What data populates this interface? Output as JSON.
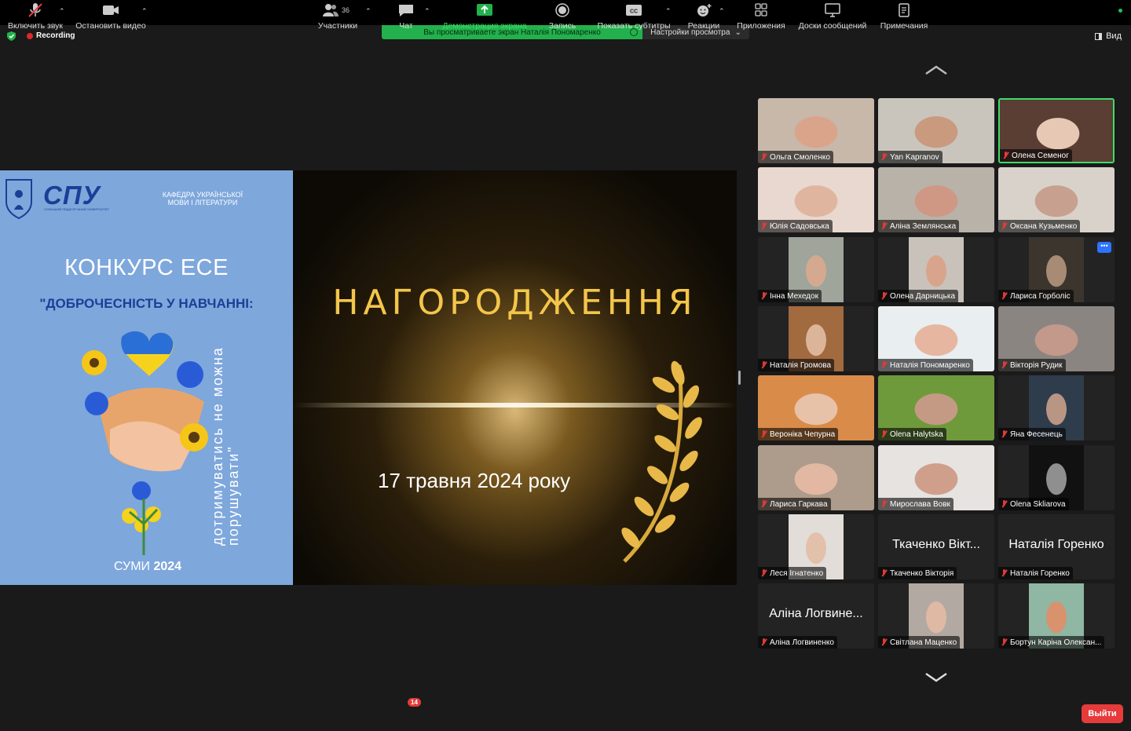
{
  "top": {
    "recording": "Recording",
    "share_banner": "Вы просматриваете экран Наталія Пономаренко",
    "view_settings": "Настройки просмотра",
    "view": "Вид"
  },
  "slide": {
    "logo": "СПУ",
    "logo_sub": "СУМСЬКИЙ ПЕДАГОГІЧНИЙ УНІВЕРСИТЕТ",
    "department": "КАФЕДРА УКРАЇНСЬКОЇ МОВИ І ЛІТЕРАТУРИ",
    "contest": "КОНКУРС ЕСЕ",
    "contest_subtitle": "\"ДОБРОЧЕСНІСТЬ У НАВЧАННІ:",
    "vertical_line1": "дотримуватись   не   можна",
    "vertical_line2": "порушувати\"",
    "city": "СУМИ",
    "year": "2024",
    "award_title": "НАГОРОДЖЕННЯ",
    "award_date": "17 травня 2024 року"
  },
  "participants": [
    {
      "name": "Ольга Смоленко",
      "video": true,
      "bg": "#c7b8aa",
      "face": "#d9a48a"
    },
    {
      "name": "Yan Kapranov",
      "video": true,
      "bg": "#c9c5bd",
      "face": "#c99a7e"
    },
    {
      "name": "Олена Семеног",
      "video": true,
      "bg": "#5a3d33",
      "face": "#e6c8b4",
      "active": true
    },
    {
      "name": "Юлія Садовська",
      "video": true,
      "bg": "#e8d8cf",
      "face": "#e0b59f"
    },
    {
      "name": "Аліна Землянська",
      "video": true,
      "bg": "#b9b2a8",
      "face": "#cf9884"
    },
    {
      "name": "Оксана Кузьменко",
      "video": true,
      "bg": "#d8d2ca",
      "face": "#c7a08f"
    },
    {
      "name": "Інна Мехедок",
      "video": true,
      "bg": "#9fa59a",
      "face": "#d4a990",
      "narrow": true
    },
    {
      "name": "Олена Дарницька",
      "video": true,
      "bg": "#c8c2bb",
      "face": "#d8a58c",
      "narrow": true
    },
    {
      "name": "Лариса Горболіс",
      "video": true,
      "bg": "#3b352e",
      "face": "#a88b75",
      "narrow": true,
      "more": true
    },
    {
      "name": "Наталія Громова",
      "video": true,
      "bg": "#a26a3f",
      "face": "#dcb49a",
      "narrow": true
    },
    {
      "name": "Наталія Пономаренко",
      "video": true,
      "bg": "#e9eef0",
      "face": "#e6b6a0"
    },
    {
      "name": "Вікторія Рудик",
      "video": true,
      "bg": "#8a8581",
      "face": "#c2998a"
    },
    {
      "name": "Вероніка Чепурна",
      "video": true,
      "bg": "#d98c4a",
      "face": "#e8c2a8"
    },
    {
      "name": "Olena Halytska",
      "video": true,
      "bg": "#6f9a3c",
      "face": "#c59a85"
    },
    {
      "name": "Яна Фесенець",
      "video": true,
      "bg": "#2f3c4b",
      "face": "#b99683",
      "narrow": true
    },
    {
      "name": "Лариса Гаркава",
      "video": true,
      "bg": "#ad9b8b",
      "face": "#e2b8a2"
    },
    {
      "name": "Мирослава Вовк",
      "video": true,
      "bg": "#e6e3e0",
      "face": "#cf9f8c"
    },
    {
      "name": "Olena Skliarova",
      "video": true,
      "bg": "#111111",
      "face": "#8f8f8f",
      "narrow": true
    },
    {
      "name": "Леся Ігнатенко",
      "video": true,
      "bg": "#e2ddd8",
      "face": "#e3c0aa",
      "narrow": true
    },
    {
      "name": "Ткаченко Вікторія",
      "video": false,
      "big": "Ткаченко Вікт..."
    },
    {
      "name": "Наталія Горенко",
      "video": false,
      "big": "Наталія Горенко"
    },
    {
      "name": "Аліна Логвиненко",
      "video": false,
      "big": "Аліна Логвине..."
    },
    {
      "name": "Світлана Маценко",
      "video": true,
      "bg": "#b2aaa2",
      "face": "#e0b9a5",
      "narrow": true
    },
    {
      "name": "Бортун Каріна Олексан...",
      "video": true,
      "bg": "#8fb7a4",
      "face": "#d8926e",
      "narrow": true
    }
  ],
  "toolbar": {
    "mute": "Включить звук",
    "video": "Остановить видео",
    "participants": "Участники",
    "participants_count": "36",
    "chat": "Чат",
    "chat_badge": "14",
    "share": "Демонстрация экрана",
    "record": "Запись",
    "captions": "Показать субтитры",
    "reactions": "Реакции",
    "apps": "Приложения",
    "whiteboards": "Доски сообщений",
    "notes": "Примечания",
    "leave": "Выйти"
  },
  "colors": {
    "share_green": "#22b14c",
    "leave_red": "#e53b3b",
    "active_border": "#3ddc6a",
    "gold": "#f3c64a"
  }
}
